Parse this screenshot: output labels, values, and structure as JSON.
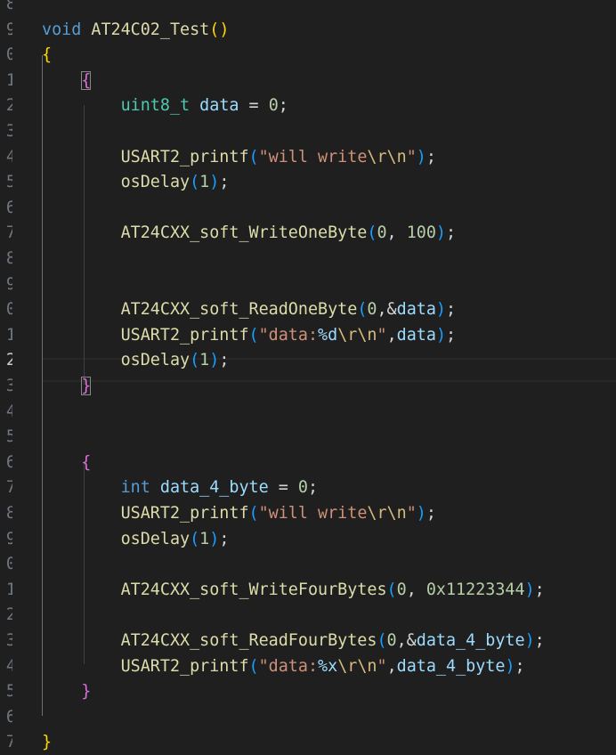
{
  "gutter": {
    "line_numbers": [
      "8",
      "9",
      "0",
      "1",
      "2",
      "3",
      "4",
      "5",
      "6",
      "7",
      "8",
      "9",
      "0",
      "1",
      "2",
      "3",
      "4",
      "5",
      "6",
      "7",
      "8",
      "9",
      "0",
      "1",
      "2",
      "3",
      "4",
      "5",
      "6",
      "7"
    ],
    "active_index": 14
  },
  "code": {
    "lines": [
      [],
      [
        {
          "t": "void",
          "c": "kw"
        },
        {
          "t": " "
        },
        {
          "t": "AT24C02_Test",
          "c": "fn"
        },
        {
          "t": "()",
          "c": "p1"
        }
      ],
      [
        {
          "t": "{",
          "c": "p1"
        }
      ],
      [
        {
          "t": "    "
        },
        {
          "t": "{",
          "c": "p2",
          "box": true
        }
      ],
      [
        {
          "t": "        "
        },
        {
          "t": "uint8_t",
          "c": "ty"
        },
        {
          "t": " "
        },
        {
          "t": "data",
          "c": "va"
        },
        {
          "t": " = ",
          "c": "op"
        },
        {
          "t": "0",
          "c": "nu"
        },
        {
          "t": ";",
          "c": "op"
        }
      ],
      [],
      [
        {
          "t": "        "
        },
        {
          "t": "USART2_printf",
          "c": "fn"
        },
        {
          "t": "(",
          "c": "p3"
        },
        {
          "t": "\"will write",
          "c": "st"
        },
        {
          "t": "\\r\\n",
          "c": "es"
        },
        {
          "t": "\"",
          "c": "st"
        },
        {
          "t": ")",
          "c": "p3"
        },
        {
          "t": ";",
          "c": "op"
        }
      ],
      [
        {
          "t": "        "
        },
        {
          "t": "osDelay",
          "c": "fn"
        },
        {
          "t": "(",
          "c": "p3"
        },
        {
          "t": "1",
          "c": "nu"
        },
        {
          "t": ")",
          "c": "p3"
        },
        {
          "t": ";",
          "c": "op"
        }
      ],
      [],
      [
        {
          "t": "        "
        },
        {
          "t": "AT24CXX_soft_WriteOneByte",
          "c": "fn"
        },
        {
          "t": "(",
          "c": "p3"
        },
        {
          "t": "0",
          "c": "nu"
        },
        {
          "t": ", ",
          "c": "op"
        },
        {
          "t": "100",
          "c": "nu"
        },
        {
          "t": ")",
          "c": "p3"
        },
        {
          "t": ";",
          "c": "op"
        }
      ],
      [],
      [],
      [
        {
          "t": "        "
        },
        {
          "t": "AT24CXX_soft_ReadOneByte",
          "c": "fn"
        },
        {
          "t": "(",
          "c": "p3"
        },
        {
          "t": "0",
          "c": "nu"
        },
        {
          "t": ",&",
          "c": "op"
        },
        {
          "t": "data",
          "c": "va"
        },
        {
          "t": ")",
          "c": "p3"
        },
        {
          "t": ";",
          "c": "op"
        }
      ],
      [
        {
          "t": "        "
        },
        {
          "t": "USART2_printf",
          "c": "fn"
        },
        {
          "t": "(",
          "c": "p3"
        },
        {
          "t": "\"data:",
          "c": "st"
        },
        {
          "t": "%d",
          "c": "fmt"
        },
        {
          "t": "\\r\\n",
          "c": "es"
        },
        {
          "t": "\"",
          "c": "st"
        },
        {
          "t": ",",
          "c": "op"
        },
        {
          "t": "data",
          "c": "va"
        },
        {
          "t": ")",
          "c": "p3"
        },
        {
          "t": ";",
          "c": "op"
        }
      ],
      [
        {
          "t": "        "
        },
        {
          "t": "osDelay",
          "c": "fn"
        },
        {
          "t": "(",
          "c": "p3"
        },
        {
          "t": "1",
          "c": "nu"
        },
        {
          "t": ")",
          "c": "p3"
        },
        {
          "t": ";",
          "c": "op"
        }
      ],
      [
        {
          "t": "    "
        },
        {
          "t": "}",
          "c": "p2",
          "box": true
        }
      ],
      [],
      [],
      [
        {
          "t": "    "
        },
        {
          "t": "{",
          "c": "p2"
        }
      ],
      [
        {
          "t": "        "
        },
        {
          "t": "int",
          "c": "kw"
        },
        {
          "t": " "
        },
        {
          "t": "data_4_byte",
          "c": "va"
        },
        {
          "t": " = ",
          "c": "op"
        },
        {
          "t": "0",
          "c": "nu"
        },
        {
          "t": ";",
          "c": "op"
        }
      ],
      [
        {
          "t": "        "
        },
        {
          "t": "USART2_printf",
          "c": "fn"
        },
        {
          "t": "(",
          "c": "p3"
        },
        {
          "t": "\"will write",
          "c": "st"
        },
        {
          "t": "\\r\\n",
          "c": "es"
        },
        {
          "t": "\"",
          "c": "st"
        },
        {
          "t": ")",
          "c": "p3"
        },
        {
          "t": ";",
          "c": "op"
        }
      ],
      [
        {
          "t": "        "
        },
        {
          "t": "osDelay",
          "c": "fn"
        },
        {
          "t": "(",
          "c": "p3"
        },
        {
          "t": "1",
          "c": "nu"
        },
        {
          "t": ")",
          "c": "p3"
        },
        {
          "t": ";",
          "c": "op"
        }
      ],
      [],
      [
        {
          "t": "        "
        },
        {
          "t": "AT24CXX_soft_WriteFourBytes",
          "c": "fn"
        },
        {
          "t": "(",
          "c": "p3"
        },
        {
          "t": "0",
          "c": "nu"
        },
        {
          "t": ", ",
          "c": "op"
        },
        {
          "t": "0x11223344",
          "c": "nu"
        },
        {
          "t": ")",
          "c": "p3"
        },
        {
          "t": ";",
          "c": "op"
        }
      ],
      [],
      [
        {
          "t": "        "
        },
        {
          "t": "AT24CXX_soft_ReadFourBytes",
          "c": "fn"
        },
        {
          "t": "(",
          "c": "p3"
        },
        {
          "t": "0",
          "c": "nu"
        },
        {
          "t": ",&",
          "c": "op"
        },
        {
          "t": "data_4_byte",
          "c": "va"
        },
        {
          "t": ")",
          "c": "p3"
        },
        {
          "t": ";",
          "c": "op"
        }
      ],
      [
        {
          "t": "        "
        },
        {
          "t": "USART2_printf",
          "c": "fn"
        },
        {
          "t": "(",
          "c": "p3"
        },
        {
          "t": "\"data:",
          "c": "st"
        },
        {
          "t": "%x",
          "c": "fmt"
        },
        {
          "t": "\\r\\n",
          "c": "es"
        },
        {
          "t": "\"",
          "c": "st"
        },
        {
          "t": ",",
          "c": "op"
        },
        {
          "t": "data_4_byte",
          "c": "va"
        },
        {
          "t": ")",
          "c": "p3"
        },
        {
          "t": ";",
          "c": "op"
        }
      ],
      [
        {
          "t": "    "
        },
        {
          "t": "}",
          "c": "p2"
        }
      ],
      [],
      [
        {
          "t": "}",
          "c": "p1"
        }
      ],
      []
    ]
  }
}
